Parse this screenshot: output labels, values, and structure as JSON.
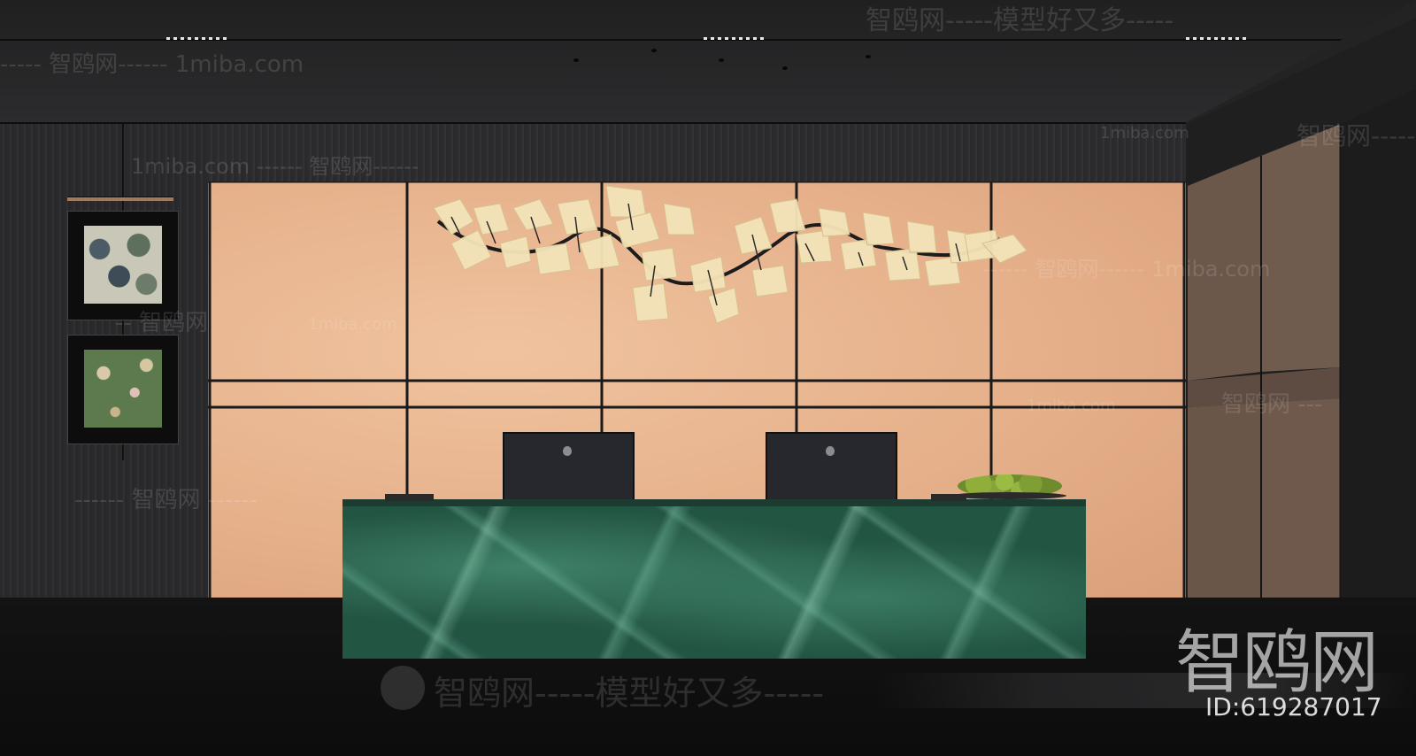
{
  "watermarks": {
    "top": "智鸥网-----模型好又多-----",
    "left_upper": "----- 智鸥网------ 1miba.com",
    "mid_left": "1miba.com ------ 智鸥网------",
    "left_mid": "-- 智鸥网",
    "center_site": "1miba.com",
    "left_lower": "------ 智鸥网 ------",
    "right_upper_site": "1miba.com",
    "right_upper": "智鸥网-----",
    "right_mid": "------ 智鸥网------ 1miba.com",
    "right_center_site": "1miba.com",
    "right_lower": "智鸥网 ---",
    "bottom": "智鸥网-----模型好又多-----",
    "logo": "智鸥网",
    "id": "ID:619287017"
  },
  "colors": {
    "ceiling": "#2a2a2b",
    "dark_wall": "#2b2b2d",
    "peach_panel": "#e8b48f",
    "marble_green": "#2f6a55",
    "floor": "#121213",
    "side_wood": "#6e5a4f"
  }
}
